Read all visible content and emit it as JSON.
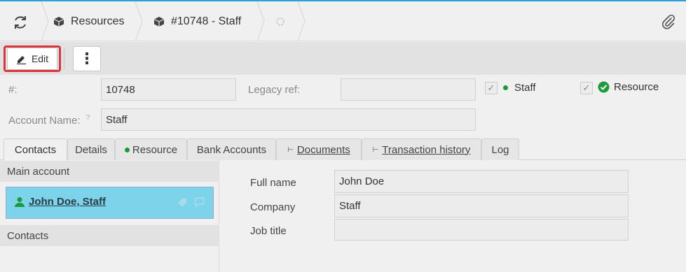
{
  "breadcrumb": {
    "items": [
      {
        "label": "Resources"
      },
      {
        "label": "#10748 - Staff"
      }
    ]
  },
  "toolbar": {
    "edit_label": "Edit",
    "more_symbol": "⋮"
  },
  "form": {
    "number_label": "#:",
    "number_value": "10748",
    "legacy_label": "Legacy ref:",
    "legacy_value": "",
    "staff_label": "Staff",
    "resource_label": "Resource",
    "account_name_label": "Account Name:",
    "help_mark": "?",
    "account_name_value": "Staff",
    "check_mark": "✓"
  },
  "tabs": [
    {
      "label": "Contacts"
    },
    {
      "label": "Details"
    },
    {
      "label": "Resource"
    },
    {
      "label": "Bank Accounts"
    },
    {
      "label": "Documents"
    },
    {
      "label": "Transaction history"
    },
    {
      "label": "Log"
    }
  ],
  "left": {
    "main_account_header": "Main account",
    "contact_name": "John Doe, Staff",
    "contacts_header": "Contacts"
  },
  "detail": {
    "full_name_label": "Full name",
    "full_name_value": "John Doe",
    "company_label": "Company",
    "company_value": "Staff",
    "job_title_label": "Job title",
    "job_title_value": ""
  },
  "colors": {
    "accent": "#2a9fd8",
    "selected_contact": "#7dd3ea",
    "status_green": "#1a9a3a",
    "highlight_red": "#d9363e"
  }
}
